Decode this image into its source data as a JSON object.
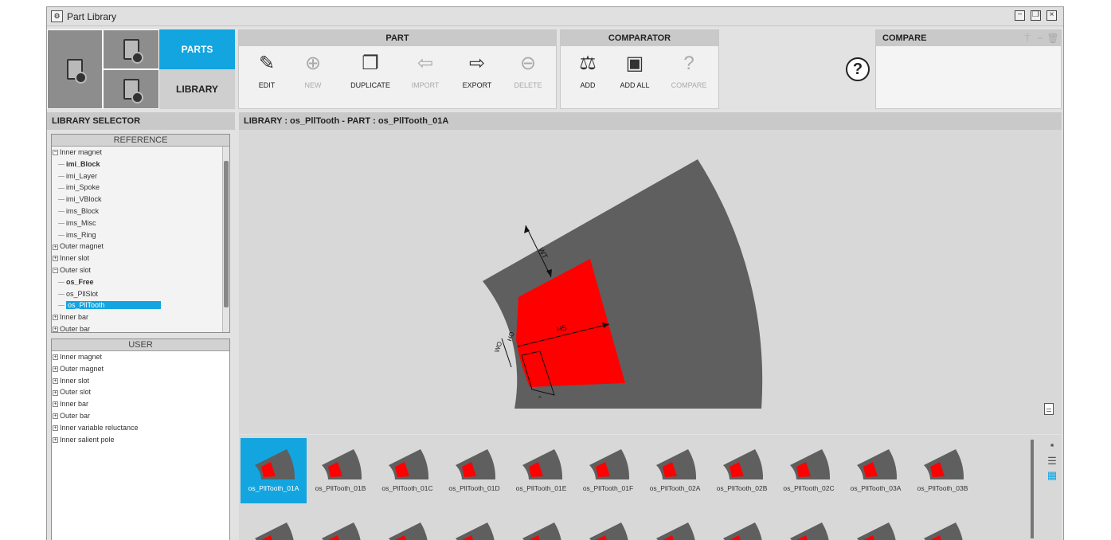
{
  "window": {
    "title": "Part Library",
    "icon": "part-library-icon"
  },
  "tabs": {
    "parts": "PARTS",
    "library": "LIBRARY"
  },
  "part_group": {
    "title": "PART",
    "buttons": [
      {
        "label": "EDIT",
        "icon": "edit-icon",
        "enabled": true
      },
      {
        "label": "NEW",
        "icon": "new-icon",
        "enabled": false
      },
      {
        "label": "DUPLICATE",
        "icon": "duplicate-icon",
        "enabled": true
      },
      {
        "label": "IMPORT",
        "icon": "import-icon",
        "enabled": false
      },
      {
        "label": "EXPORT",
        "icon": "export-icon",
        "enabled": true
      },
      {
        "label": "DELETE",
        "icon": "delete-icon",
        "enabled": false
      }
    ]
  },
  "comparator_group": {
    "title": "COMPARATOR",
    "buttons": [
      {
        "label": "ADD",
        "icon": "add-to-comparator-icon",
        "enabled": true
      },
      {
        "label": "ADD ALL",
        "icon": "add-all-icon",
        "enabled": true
      },
      {
        "label": "COMPARE",
        "icon": "compare-icon",
        "enabled": false
      }
    ]
  },
  "help": {
    "label": "?"
  },
  "compare_panel": {
    "title": "COMPARE"
  },
  "library_selector": {
    "title": "LIBRARY SELECTOR",
    "reference": {
      "title": "REFERENCE",
      "items": [
        {
          "label": "Inner magnet",
          "level": 0,
          "expander": "⊟"
        },
        {
          "label": "imi_Block",
          "level": 1,
          "bold": true
        },
        {
          "label": "imi_Layer",
          "level": 1
        },
        {
          "label": "imi_Spoke",
          "level": 1
        },
        {
          "label": "imi_VBlock",
          "level": 1
        },
        {
          "label": "ims_Block",
          "level": 1
        },
        {
          "label": "ims_Misc",
          "level": 1
        },
        {
          "label": "ims_Ring",
          "level": 1
        },
        {
          "label": "Outer magnet",
          "level": 0,
          "expander": "+"
        },
        {
          "label": "Inner slot",
          "level": 0,
          "expander": "+"
        },
        {
          "label": "Outer slot",
          "level": 0,
          "expander": "⊟"
        },
        {
          "label": "os_Free",
          "level": 1,
          "bold": true
        },
        {
          "label": "os_PllSlot",
          "level": 1
        },
        {
          "label": "os_PllTooth",
          "level": 1,
          "selected": true
        },
        {
          "label": "Inner bar",
          "level": 0,
          "expander": "+"
        },
        {
          "label": "Outer bar",
          "level": 0,
          "expander": "+"
        }
      ]
    },
    "user": {
      "title": "USER",
      "items": [
        "Inner magnet",
        "Outer magnet",
        "Inner slot",
        "Outer slot",
        "Inner bar",
        "Outer bar",
        "Inner variable reluctance",
        "Inner salient pole"
      ]
    }
  },
  "main": {
    "header": "LIBRARY : os_PllTooth  -  PART : os_PllTooth_01A",
    "drawing_labels": {
      "wt": "WT",
      "hs": "HS",
      "wo": "WO",
      "ho": "HO"
    }
  },
  "thumbnails": [
    {
      "label": "os_PllTooth_01A",
      "selected": true
    },
    {
      "label": "os_PllTooth_01B"
    },
    {
      "label": "os_PllTooth_01C"
    },
    {
      "label": "os_PllTooth_01D"
    },
    {
      "label": "os_PllTooth_01E"
    },
    {
      "label": "os_PllTooth_01F"
    },
    {
      "label": "os_PllTooth_02A"
    },
    {
      "label": "os_PllTooth_02B"
    },
    {
      "label": "os_PllTooth_02C"
    },
    {
      "label": "os_PllTooth_03A"
    },
    {
      "label": "os_PllTooth_03B"
    }
  ],
  "colors": {
    "accent": "#12a5e0",
    "stator": "#5f5f5f",
    "slot": "#ff0000",
    "panel": "#d8d8d8"
  }
}
